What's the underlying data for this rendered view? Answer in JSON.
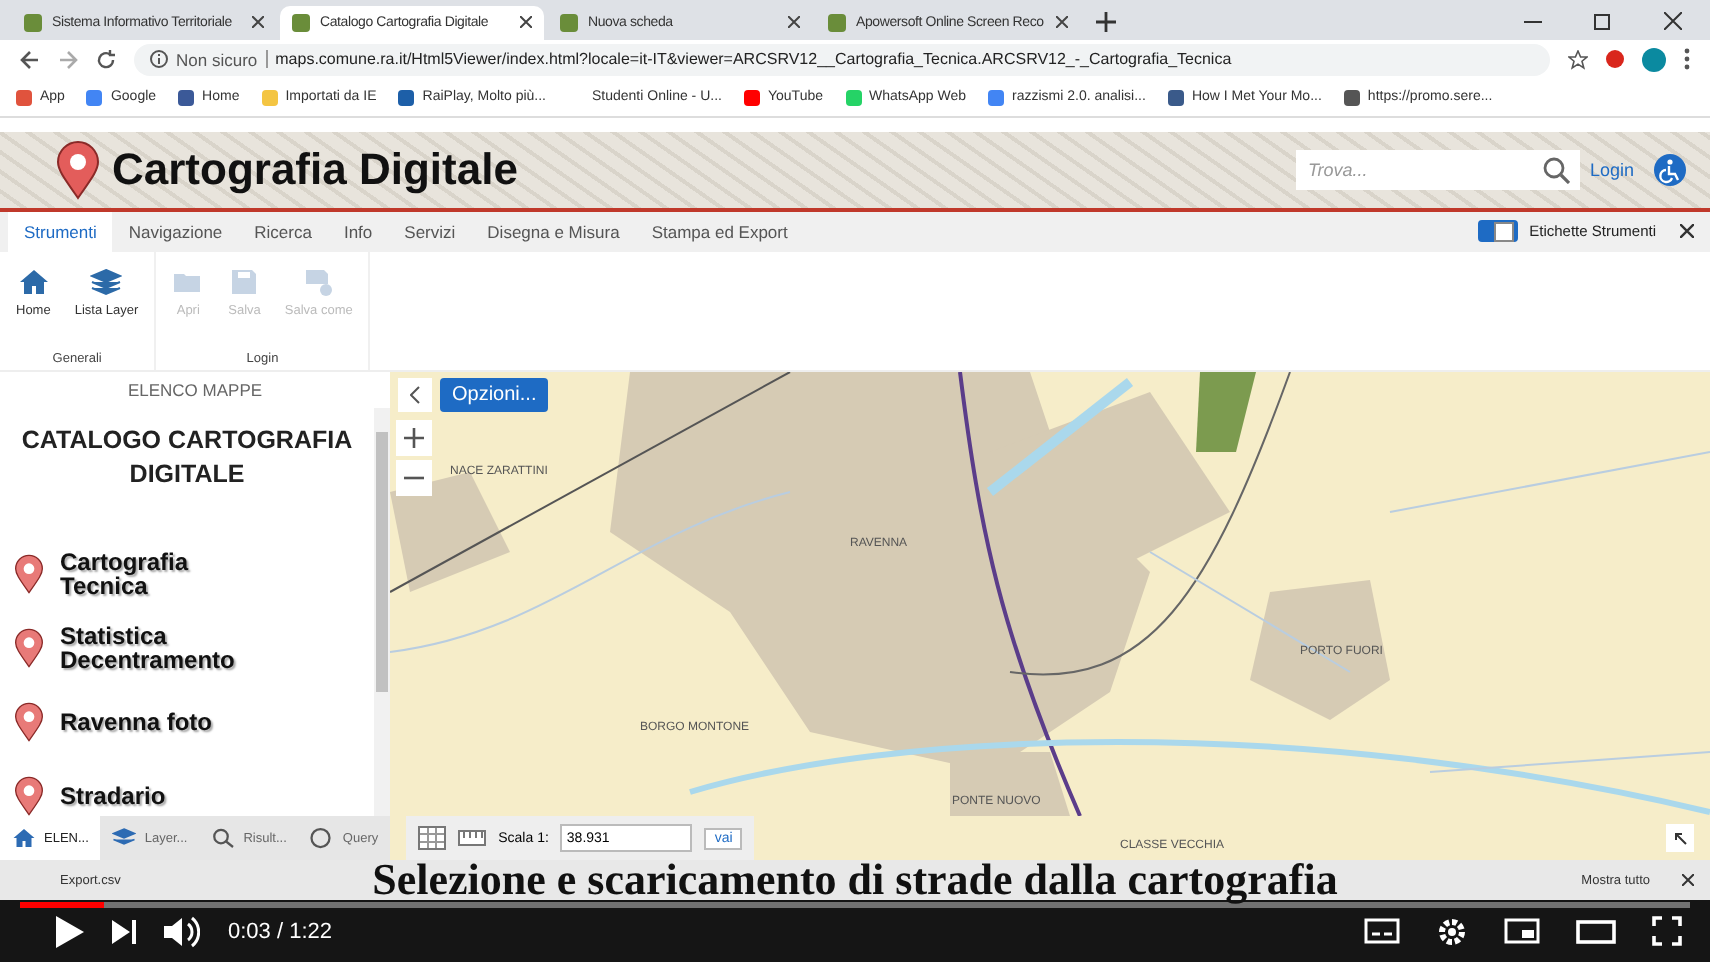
{
  "browser_tabs": [
    {
      "title": "Sistema Informativo Territoriale",
      "selected": false
    },
    {
      "title": "Catalogo Cartografia Digitale",
      "selected": true
    },
    {
      "title": "Nuova scheda",
      "selected": false
    },
    {
      "title": "Apowersoft Online Screen Reco",
      "selected": false
    }
  ],
  "address_bar": {
    "security": "Non sicuro",
    "url": "maps.comune.ra.it/Html5Viewer/index.html?locale=it-IT&viewer=ARCSRV12__Cartografia_Tecnica.ARCSRV12_-_Cartografia_Tecnica"
  },
  "bookmarks": [
    "App",
    "Google",
    "Home",
    "Importati da IE",
    "RaiPlay, Molto più...",
    "Studenti Online - U...",
    "YouTube",
    "WhatsApp Web",
    "razzismi 2.0. analisi...",
    "How I Met Your Mo...",
    "https://promo.sere..."
  ],
  "header": {
    "title": "Cartografia Digitale",
    "search": {
      "placeholder": "Trova..."
    },
    "login": "Login"
  },
  "ribbon": {
    "tabs": [
      {
        "label": "Strumenti",
        "selected": true
      },
      {
        "label": "Navigazione",
        "selected": false
      },
      {
        "label": "Ricerca",
        "selected": false
      },
      {
        "label": "Info",
        "selected": false
      },
      {
        "label": "Servizi",
        "selected": false
      },
      {
        "label": "Disegna e Misura",
        "selected": false
      },
      {
        "label": "Stampa ed Export",
        "selected": false
      }
    ],
    "toggle": {
      "label": "Etichette Strumenti",
      "on": true
    },
    "groups": [
      {
        "label": "Generali",
        "tools": [
          {
            "label": "Home",
            "kind": "home",
            "disabled": false
          },
          {
            "label": "Lista Layer",
            "kind": "layers",
            "disabled": false
          }
        ]
      },
      {
        "label": "Login",
        "tools": [
          {
            "label": "Apri",
            "kind": "open",
            "disabled": true
          },
          {
            "label": "Salva",
            "kind": "save",
            "disabled": true
          },
          {
            "label": "Salva come",
            "kind": "saveas",
            "disabled": true
          }
        ]
      }
    ]
  },
  "left_panel": {
    "title": "ELENCO MAPPE",
    "heading": "CATALOGO CARTOGRAFIA DIGITALE",
    "maps": [
      "Cartografia Tecnica",
      "Statistica Decentramento",
      "Ravenna foto",
      "Stradario"
    ]
  },
  "map": {
    "options_button": "Opzioni...",
    "labels": [
      "NACE ZARATTINI",
      "RAVENNA",
      "BORGO MONTONE",
      "PONTE NUOVO",
      "PORTO FUORI",
      "CLASSE VECCHIA"
    ]
  },
  "bottom_bar": {
    "tabs": [
      {
        "label": "ELEN...",
        "selected": true
      },
      {
        "label": "Layer...",
        "selected": false
      },
      {
        "label": "Risult...",
        "selected": false
      },
      {
        "label": "Query",
        "selected": false
      }
    ],
    "scale_label": "Scala 1:",
    "scale_value": "38.931",
    "scale_button": "vai"
  },
  "downloads": {
    "file": "Export.csv",
    "show_all": "Mostra tutto"
  },
  "video": {
    "caption": "Selezione e scaricamento di strade dalla cartografia",
    "time": "0:03 / 1:22",
    "progress": {
      "level": 0.05
    }
  }
}
